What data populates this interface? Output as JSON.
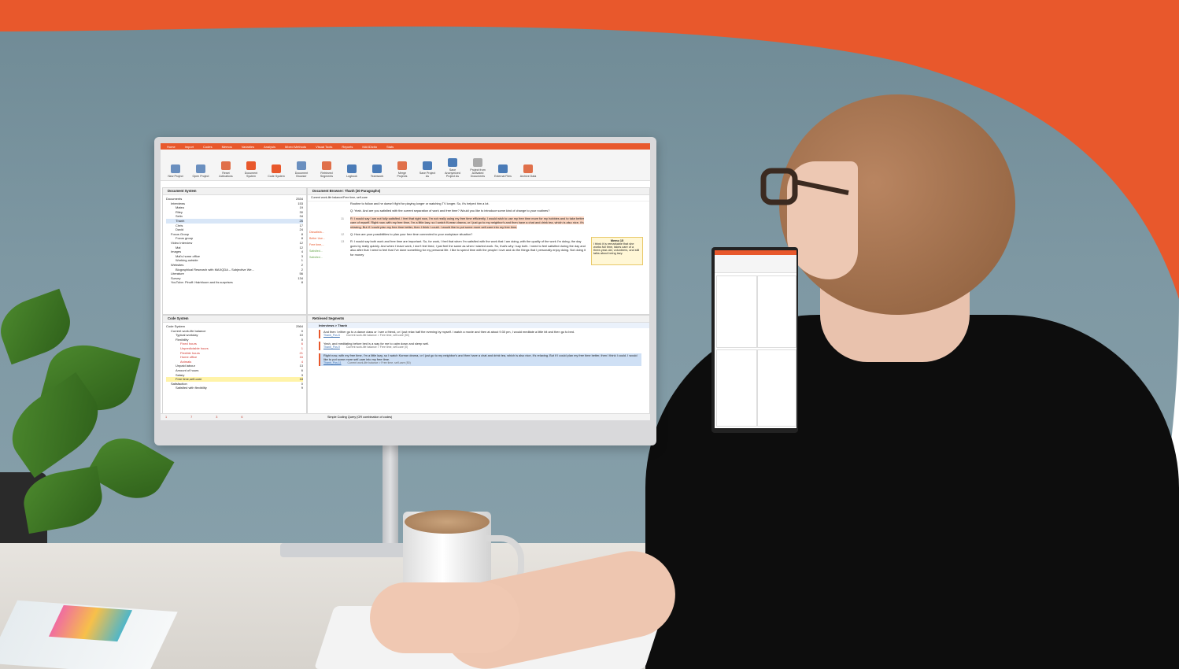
{
  "app": {
    "ribbon_tabs": [
      "Home",
      "Import",
      "Codes",
      "Memos",
      "Variables",
      "Analysis",
      "Mixed Methods",
      "Visual Tools",
      "Reports",
      "MAXDictio",
      "Stats"
    ],
    "toolbar_buttons": [
      "New Project",
      "Open Project",
      "Reset Activations",
      "Document System",
      "Code System",
      "Document Browser",
      "Retrieved Segments",
      "Logbook",
      "Teamwork",
      "Merge Projects",
      "Save Project As",
      "Save Anonymized Project As",
      "Project from Activated Documents",
      "External Files",
      "Archive Data"
    ]
  },
  "document_system": {
    "title": "Document System",
    "items": [
      {
        "label": "Documents",
        "count": "2534"
      },
      {
        "label": "Interviews",
        "count": "153"
      },
      {
        "label": "Mateo",
        "count": "19"
      },
      {
        "label": "Riley",
        "count": "30"
      },
      {
        "label": "Selin",
        "count": "34"
      },
      {
        "label": "Thanh",
        "count": "26"
      },
      {
        "label": "Chris",
        "count": "17"
      },
      {
        "label": "David",
        "count": "24"
      },
      {
        "label": "Focus Group",
        "count": "8"
      },
      {
        "label": "Focus group",
        "count": "8"
      },
      {
        "label": "Video Interview",
        "count": "12"
      },
      {
        "label": "Mal",
        "count": "12"
      },
      {
        "label": "Images",
        "count": "4"
      },
      {
        "label": "Mal's home office",
        "count": "3"
      },
      {
        "label": "Working outside",
        "count": "1"
      },
      {
        "label": "Websites",
        "count": "2"
      },
      {
        "label": "Biographical Research with MAXQDA – Subjective We...",
        "count": "2"
      },
      {
        "label": "Literature",
        "count": "56"
      },
      {
        "label": "Survey",
        "count": "134"
      },
      {
        "label": "YouTube: Pinoff: Hairbloom and its surprises",
        "count": "8"
      }
    ]
  },
  "document_browser": {
    "title": "Document Browser: Thanh  (30 Paragraphs)",
    "code_filter": "Current work-life balance\\Free time, self-care",
    "paragraphs": [
      {
        "num": "",
        "text": "Routine to follow and he doesn't fight for playing longer or watching TV longer. So, it's helped him a lot."
      },
      {
        "num": "",
        "text": "Q: Yeah. And are you satisfied with the current separation of work and free time? Would you like to introduce some kind of change to your routines?"
      },
      {
        "num": "11",
        "text": "R: I would say I am not fully satisfied. I feel that right now, I'm not really using my free time efficiently. I would wish to use my free time more for my hobbies and to take better care of myself. Right now, with my free time, I'm a little lazy, so I watch Korean drama, or I just go to my neighbor's and then have a chat and drink tea, which is also nice, it's relaxing. But if I could plan my free time better, then I think I could. I would like to put some more self-care into my free time."
      },
      {
        "num": "12",
        "text": "Q: How are your possibilities to plan your free time connected to your workplace situation?"
      },
      {
        "num": "13",
        "text": "R: I would say both work and free time are important. So, for work, I feel that when I'm satisfied with the work that I am doing, with the quality of the work I'm doing, the day goes by really quickly. And when I leave work, I don't feel tired, I just feel the same as when I started work. So, that's why I say both. I need to feel satisfied during the day and also after that I need to feel that I've done something for my personal life. I like to spend time with the people I love and do the things that I personally enjoy doing. Not doing it for money"
      }
    ],
    "margin_codes": [
      "Dissatisfa...",
      "Better Use...",
      "Free time,...",
      "Satisfied...",
      "Satisfied..."
    ],
    "memo": {
      "title": "Memo 15",
      "text": "I think it is remarkable that she works full time, takes care of a three-year-old, volunteers, and still talks about being lazy."
    }
  },
  "code_system": {
    "title": "Code System",
    "items": [
      {
        "label": "Code System",
        "count": "2564"
      },
      {
        "label": "Current work-life balance",
        "count": "0"
      },
      {
        "label": "Typical workday",
        "count": "10"
      },
      {
        "label": "Flexibility",
        "count": "0"
      },
      {
        "label": "Fixed hours",
        "count": "6"
      },
      {
        "label": "Unpredictable hours",
        "count": "1"
      },
      {
        "label": "Flexible hours",
        "count": "21"
      },
      {
        "label": "Home office",
        "count": "16"
      },
      {
        "label": "Animals",
        "count": "4"
      },
      {
        "label": "Unpaid labour",
        "count": "13"
      },
      {
        "label": "Amount of hours",
        "count": "6"
      },
      {
        "label": "Salary",
        "count": "3"
      },
      {
        "label": "Free time,self-care",
        "count": "18"
      },
      {
        "label": "Satisfaction",
        "count": "0"
      },
      {
        "label": "Satisfied with flexibility",
        "count": "9"
      }
    ],
    "status_counts": [
      "1",
      "7",
      "3",
      "6"
    ]
  },
  "retrieved_segments": {
    "title": "Retrieved Segments",
    "header": "Interviews > Thanh",
    "segments": [
      {
        "text": "And then I either go to a dance class or I see a friend, or I just relax half the evening by myself. I watch a movie and then at about 9:30 pm, I would meditate a little bit and then go to bed.",
        "source": "Thanh_Pos.5",
        "code": "Current work-life balance > Free time, self-care (50)"
      },
      {
        "text": "Yeah, and meditating before bed is a way for me to calm down and sleep well.",
        "source": "Thanh_Pos.9",
        "code": "Current work-life balance > Free time, self-care (0)"
      },
      {
        "text": "Right now, with my free time, I'm a little lazy, so I watch Korean drama, or I just go to my neighbor's and then have a chat and drink tea, which is also nice, it's relaxing. But if I could plan my free time better, then I think I could. I would like to put some more self-care into my free time.",
        "source": "Thanh_Pos.11",
        "code": "Current work-life balance > Free time, self-care (50)"
      }
    ]
  },
  "status_bar": {
    "query": "Simple Coding Query (OR combination of codes)"
  },
  "colors": {
    "brand": "#e8582c",
    "accent": "#f07b3f",
    "wall": "#7e98a3"
  }
}
